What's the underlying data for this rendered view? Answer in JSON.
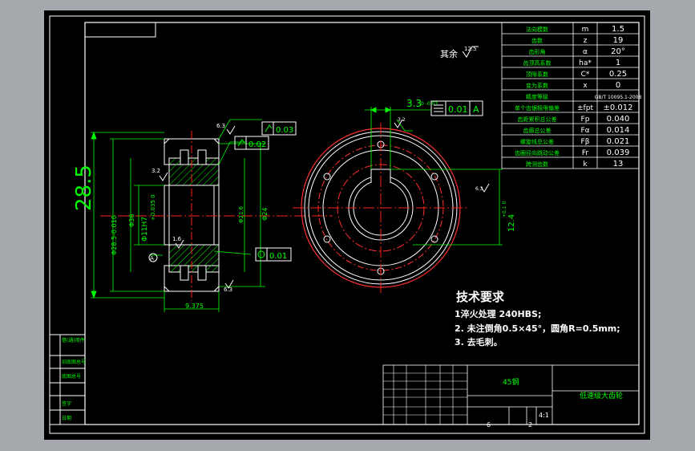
{
  "params": {
    "rows": [
      {
        "label": "法向模数",
        "symbol": "m",
        "value": "1.5"
      },
      {
        "label": "齿数",
        "symbol": "z",
        "value": "19"
      },
      {
        "label": "齿形角",
        "symbol": "α",
        "value": "20°"
      },
      {
        "label": "齿顶高系数",
        "symbol": "ha*",
        "value": "1"
      },
      {
        "label": "顶隙系数",
        "symbol": "C*",
        "value": "0.25"
      },
      {
        "label": "变为系数",
        "symbol": "x",
        "value": "0"
      },
      {
        "label": "精度等级",
        "symbol": "",
        "value": "GB/T 10095.1-2008"
      },
      {
        "label": "单个齿锯极限偏差",
        "symbol": "±fpt",
        "value": "±0.012"
      },
      {
        "label": "齿距累积总公差",
        "symbol": "Fp",
        "value": "0.040"
      },
      {
        "label": "齿廓总公差",
        "symbol": "Fα",
        "value": "0.014"
      },
      {
        "label": "螺旋线总公差",
        "symbol": "Fβ",
        "value": "0.021"
      },
      {
        "label": "齿圈径向跳动公差",
        "symbol": "Fr",
        "value": "0.039"
      },
      {
        "label": "跨测齿数",
        "symbol": "k",
        "value": "13"
      }
    ]
  },
  "roughness_note": {
    "text": "其余",
    "value": "12.5"
  },
  "dims": {
    "overall_dia": "28.5",
    "tip_dia": "Φ28.5-0.010",
    "dia_36": "Φ36",
    "bore": "Φ11H7",
    "bore_tol": "+0.035 0",
    "dia_24": "Φ24",
    "dia_21": "Φ21.6",
    "width": "9.375",
    "keyway_width": "3.3",
    "keyway_tol": "0 -0.03",
    "keyway_depth": "12.4",
    "keyway_depth_tol": "+0.1 0",
    "r1": "1.6",
    "r2": "3.2",
    "r3": "6.3",
    "r4": "12.5",
    "r5": "3.2",
    "r6": "1.6",
    "r7": "6.3"
  },
  "tolerances": {
    "runout1": "0.03",
    "runout2": "0.02",
    "flat": "0.01",
    "sym": "0.01",
    "datum": "A"
  },
  "tech_req": {
    "title": "技术要求",
    "items": [
      "1淬火处理 240HBS;",
      "2. 未注倒角0.5×45°，圆角R=0.5mm;",
      "3. 去毛刺。"
    ]
  },
  "title_block": {
    "material": "45钢",
    "name": "低速级大齿轮",
    "scale": "4:1",
    "sheets": "6",
    "sheet_no": "2"
  },
  "left_strip": {
    "labels": [
      "借(通)用件",
      "旧底图总号",
      "底图总号",
      "签字",
      "日期"
    ]
  }
}
